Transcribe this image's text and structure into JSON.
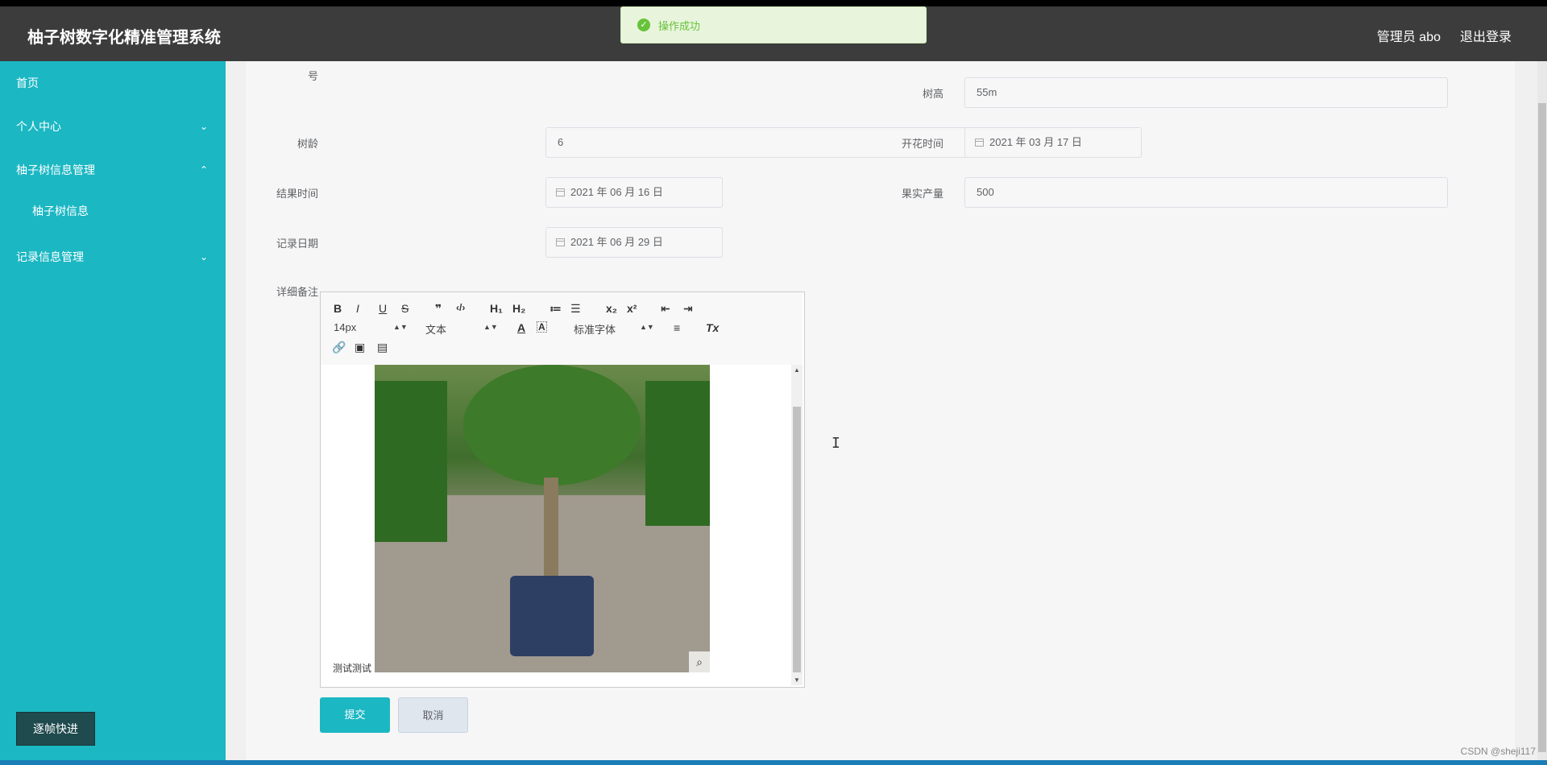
{
  "header": {
    "title": "柚子树数字化精准管理系统",
    "user": "管理员 abo",
    "logout": "退出登录"
  },
  "toast": {
    "message": "操作成功",
    "icon": "success-check-icon"
  },
  "sidebar": {
    "items": [
      {
        "label": "首页"
      },
      {
        "label": "个人中心",
        "arrow": "⌄"
      },
      {
        "label": "柚子树信息管理",
        "arrow": "⌃"
      },
      {
        "label": "柚子树信息"
      },
      {
        "label": "记录信息管理",
        "arrow": "⌄"
      }
    ],
    "bottom_button": "逐帧快进"
  },
  "form": {
    "truncated_label": "号",
    "tree_height": {
      "label": "树高",
      "value": "55m"
    },
    "tree_age": {
      "label": "树龄",
      "value": "6"
    },
    "bloom_time": {
      "label": "开花时间",
      "value": "2021 年 03 月 17 日"
    },
    "fruit_time": {
      "label": "结果时间",
      "value": "2021 年 06 月 16 日"
    },
    "fruit_yield": {
      "label": "果实产量",
      "value": "500"
    },
    "record_date": {
      "label": "记录日期",
      "value": "2021 年 06 月 29 日"
    },
    "notes": {
      "label": "详细备注",
      "text": "测试测试"
    }
  },
  "editor": {
    "toolbar_row1": [
      "B",
      "I",
      "U",
      "S",
      "❞",
      "‹/›",
      "H₁",
      "H₂",
      "≔",
      "☰",
      "x₂",
      "x²",
      "⇤",
      "⇥"
    ],
    "size_select": "14px",
    "type_select": "文本",
    "font_select": "标准字体",
    "color_icons": [
      "A",
      "A"
    ],
    "align_icon": "≡",
    "clear_icon": "Tx",
    "toolbar_row3": [
      "🔗",
      "▣",
      "▤"
    ]
  },
  "buttons": {
    "submit": "提交",
    "cancel": "取消"
  },
  "watermark": "CSDN @sheji117",
  "colors": {
    "sidebar": "#1bb7c3",
    "header": "#3c3c3c",
    "success": "#67c23a"
  }
}
